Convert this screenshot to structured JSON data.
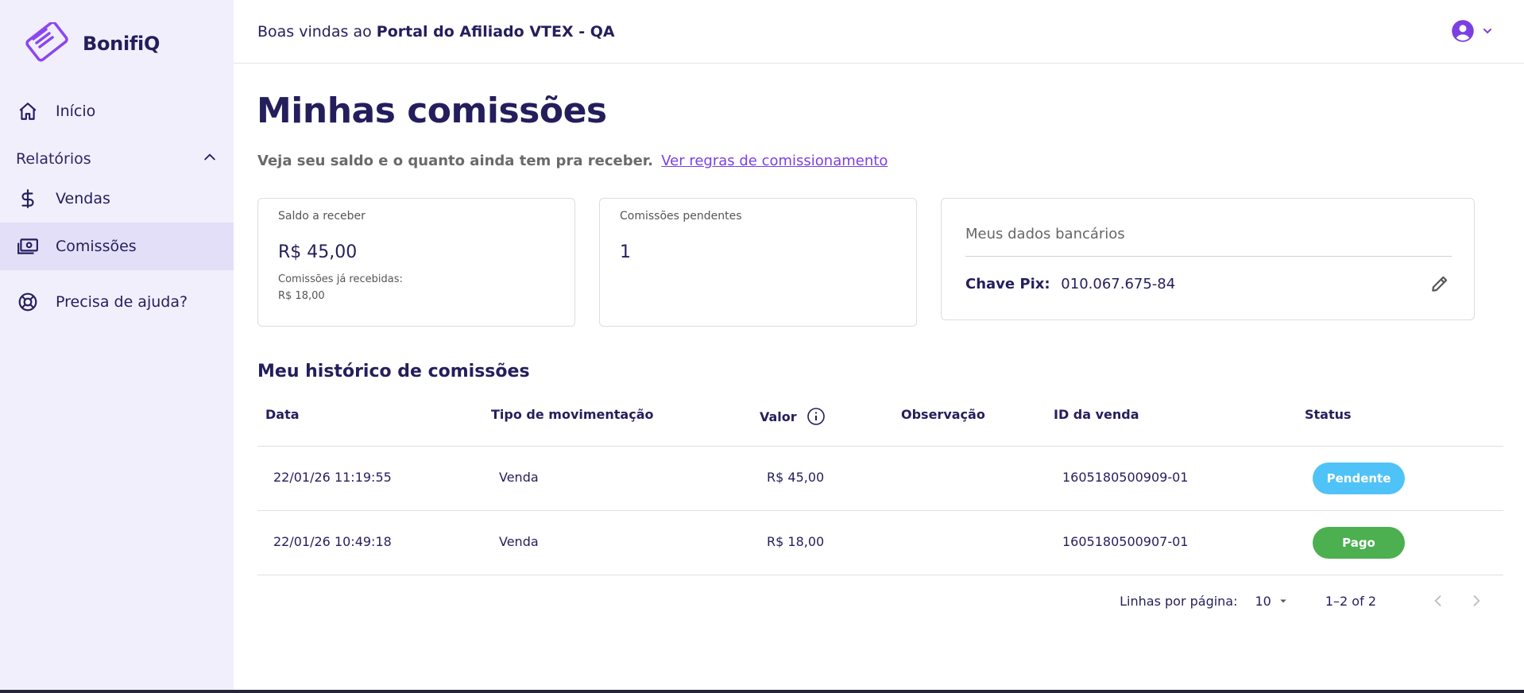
{
  "app": {
    "brand": "BonifiQ"
  },
  "colors": {
    "accent": "#7b3fe4",
    "navy": "#241e5c",
    "pending": "#4fc3f7",
    "paid": "#4caf50"
  },
  "sidebar": {
    "items": [
      {
        "label": "Início",
        "icon": "home-icon"
      },
      {
        "label": "Vendas",
        "icon": "dollar-icon"
      },
      {
        "label": "Comissões",
        "icon": "cash-icon",
        "active": true
      },
      {
        "label": "Precisa de ajuda?",
        "icon": "lifebuoy-icon"
      }
    ],
    "section": {
      "label": "Relatórios",
      "icon": "chevron-up-icon"
    }
  },
  "header": {
    "welcome_prefix": "Boas vindas ao",
    "portal_name": "Portal do Afiliado VTEX - QA",
    "user_icon": "user-circle-icon"
  },
  "page": {
    "title": "Minhas comissões",
    "subtitle": "Veja seu saldo e o quanto ainda tem pra receber.",
    "rules_link": "Ver regras de comissionamento"
  },
  "cards": {
    "balance": {
      "label": "Saldo a receber",
      "value": "R$ 45,00",
      "received_label": "Comissões já recebidas:",
      "received_value": "R$ 18,00"
    },
    "pending": {
      "label": "Comissões pendentes",
      "value": "1"
    },
    "bank": {
      "title": "Meus dados bancários",
      "pix_label": "Chave Pix:",
      "pix_value": "010.067.675-84",
      "edit_icon": "pencil-icon"
    }
  },
  "history": {
    "title": "Meu histórico de comissões",
    "columns": [
      "Data",
      "Tipo de movimentação",
      "Valor",
      "Observação",
      "ID da venda",
      "Status"
    ],
    "rows": [
      {
        "date": "22/01/26 11:19:55",
        "type": "Venda",
        "value": "R$ 45,00",
        "note": "",
        "sale_id": "1605180500909-01",
        "status": "Pendente"
      },
      {
        "date": "22/01/26 10:49:18",
        "type": "Venda",
        "value": "R$ 18,00",
        "note": "",
        "sale_id": "1605180500907-01",
        "status": "Pago"
      }
    ]
  },
  "pagination": {
    "rows_label": "Linhas por página:",
    "rows_per_page": "10",
    "range": "1–2 of 2"
  }
}
